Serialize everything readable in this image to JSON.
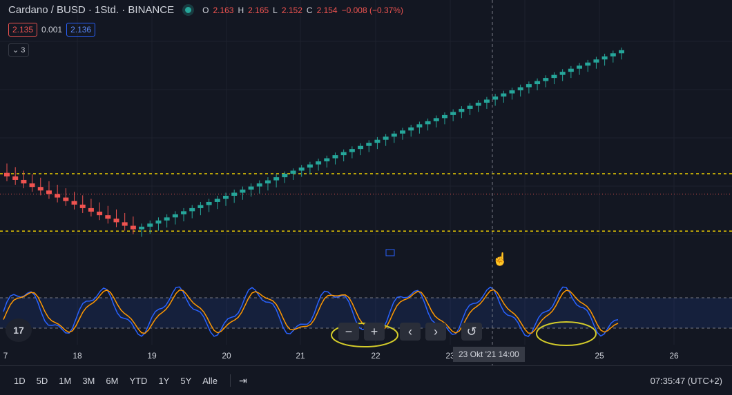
{
  "header": {
    "symbol": "Cardano / BUSD · 1Std. · BINANCE",
    "open_key": "O",
    "open_val": "2.163",
    "high_key": "H",
    "high_val": "2.165",
    "low_key": "L",
    "low_val": "2.152",
    "close_key": "C",
    "close_val": "2.154",
    "change": "−0.008 (−0.37%)"
  },
  "quote": {
    "bid": "2.135",
    "spread": "0.001",
    "ask": "2.136"
  },
  "indicators": {
    "toggle_label": "⌄ 3"
  },
  "logo_text": "17",
  "controls": {
    "zoom_out": "−",
    "zoom_in": "+",
    "scroll_left": "‹",
    "scroll_right": "›",
    "reset": "↺"
  },
  "x_axis": {
    "labels": [
      "7",
      "18",
      "19",
      "20",
      "21",
      "22",
      "23",
      "25",
      "26"
    ]
  },
  "crosshair_label": "23 Okt '21   14:00",
  "bottom_bar": {
    "ranges": [
      "1D",
      "5D",
      "1M",
      "3M",
      "6M",
      "YTD",
      "1Y",
      "5Y",
      "Alle"
    ],
    "goto_icon": "goto-date-icon",
    "clock": "07:35:47 (UTC+2)"
  },
  "colors": {
    "up": "#26a69a",
    "down": "#ef5350",
    "k_line": "#2962ff",
    "d_line": "#ff9800",
    "level": "#f0d000",
    "highlight": "#d4cc2a"
  },
  "chart_data": {
    "type": "candlestick",
    "x_unit": "hour",
    "price_levels": {
      "resistance": 2.2,
      "support": 2.07,
      "last_price": 2.154
    },
    "candles": [
      [
        2.202,
        2.223,
        2.183,
        2.194
      ],
      [
        2.194,
        2.215,
        2.175,
        2.186
      ],
      [
        2.186,
        2.207,
        2.167,
        2.178
      ],
      [
        2.178,
        2.199,
        2.159,
        2.17
      ],
      [
        2.17,
        2.191,
        2.151,
        2.162
      ],
      [
        2.162,
        2.183,
        2.143,
        2.154
      ],
      [
        2.154,
        2.175,
        2.135,
        2.146
      ],
      [
        2.146,
        2.167,
        2.127,
        2.138
      ],
      [
        2.138,
        2.159,
        2.119,
        2.13
      ],
      [
        2.13,
        2.151,
        2.111,
        2.122
      ],
      [
        2.122,
        2.143,
        2.103,
        2.114
      ],
      [
        2.114,
        2.135,
        2.095,
        2.106
      ],
      [
        2.106,
        2.127,
        2.087,
        2.098
      ],
      [
        2.098,
        2.119,
        2.079,
        2.09
      ],
      [
        2.09,
        2.111,
        2.071,
        2.082
      ],
      [
        2.082,
        2.103,
        2.063,
        2.074
      ],
      [
        2.074,
        2.087,
        2.057,
        2.08
      ],
      [
        2.08,
        2.094,
        2.064,
        2.087
      ],
      [
        2.087,
        2.101,
        2.071,
        2.094
      ],
      [
        2.094,
        2.108,
        2.078,
        2.101
      ],
      [
        2.101,
        2.115,
        2.085,
        2.108
      ],
      [
        2.108,
        2.122,
        2.092,
        2.115
      ],
      [
        2.115,
        2.129,
        2.099,
        2.122
      ],
      [
        2.122,
        2.136,
        2.106,
        2.129
      ],
      [
        2.129,
        2.143,
        2.113,
        2.136
      ],
      [
        2.136,
        2.15,
        2.12,
        2.143
      ],
      [
        2.143,
        2.157,
        2.127,
        2.15
      ],
      [
        2.15,
        2.164,
        2.134,
        2.157
      ],
      [
        2.157,
        2.171,
        2.141,
        2.164
      ],
      [
        2.164,
        2.178,
        2.148,
        2.171
      ],
      [
        2.171,
        2.185,
        2.155,
        2.178
      ],
      [
        2.178,
        2.192,
        2.162,
        2.185
      ],
      [
        2.185,
        2.199,
        2.169,
        2.192
      ],
      [
        2.192,
        2.205,
        2.179,
        2.2
      ],
      [
        2.2,
        2.212,
        2.186,
        2.207
      ],
      [
        2.207,
        2.22,
        2.193,
        2.214
      ],
      [
        2.214,
        2.227,
        2.2,
        2.221
      ],
      [
        2.221,
        2.234,
        2.207,
        2.228
      ],
      [
        2.228,
        2.241,
        2.214,
        2.235
      ],
      [
        2.235,
        2.248,
        2.221,
        2.242
      ],
      [
        2.242,
        2.255,
        2.228,
        2.249
      ],
      [
        2.249,
        2.262,
        2.235,
        2.256
      ],
      [
        2.256,
        2.269,
        2.242,
        2.263
      ],
      [
        2.263,
        2.276,
        2.249,
        2.27
      ],
      [
        2.27,
        2.283,
        2.256,
        2.277
      ],
      [
        2.277,
        2.29,
        2.263,
        2.284
      ],
      [
        2.284,
        2.297,
        2.27,
        2.291
      ],
      [
        2.291,
        2.304,
        2.277,
        2.298
      ],
      [
        2.298,
        2.311,
        2.284,
        2.305
      ],
      [
        2.305,
        2.318,
        2.291,
        2.312
      ],
      [
        2.312,
        2.325,
        2.298,
        2.319
      ],
      [
        2.319,
        2.332,
        2.305,
        2.326
      ],
      [
        2.326,
        2.339,
        2.312,
        2.333
      ],
      [
        2.333,
        2.346,
        2.319,
        2.34
      ],
      [
        2.34,
        2.353,
        2.326,
        2.347
      ],
      [
        2.347,
        2.36,
        2.333,
        2.354
      ],
      [
        2.354,
        2.367,
        2.34,
        2.361
      ],
      [
        2.361,
        2.374,
        2.347,
        2.368
      ],
      [
        2.368,
        2.381,
        2.354,
        2.375
      ],
      [
        2.375,
        2.388,
        2.361,
        2.382
      ],
      [
        2.382,
        2.395,
        2.368,
        2.389
      ],
      [
        2.389,
        2.402,
        2.375,
        2.396
      ],
      [
        2.396,
        2.409,
        2.382,
        2.403
      ],
      [
        2.403,
        2.416,
        2.389,
        2.41
      ],
      [
        2.41,
        2.423,
        2.396,
        2.417
      ],
      [
        2.417,
        2.43,
        2.403,
        2.424
      ],
      [
        2.424,
        2.437,
        2.41,
        2.431
      ],
      [
        2.431,
        2.444,
        2.417,
        2.438
      ],
      [
        2.438,
        2.451,
        2.424,
        2.445
      ],
      [
        2.445,
        2.458,
        2.431,
        2.452
      ],
      [
        2.452,
        2.465,
        2.438,
        2.459
      ],
      [
        2.459,
        2.472,
        2.445,
        2.466
      ],
      [
        2.466,
        2.479,
        2.452,
        2.473
      ],
      [
        2.473,
        2.486,
        2.459,
        2.48
      ]
    ]
  }
}
